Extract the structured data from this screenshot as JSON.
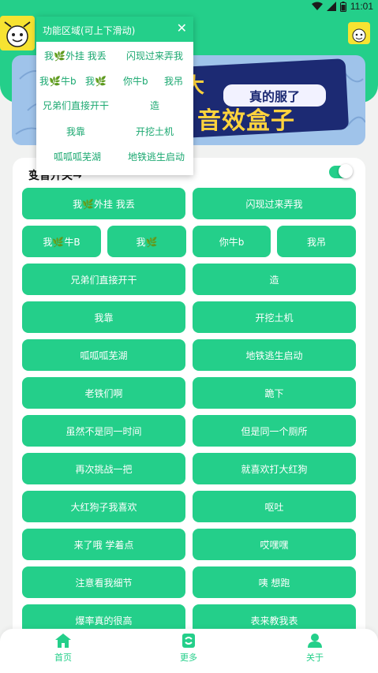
{
  "status_bar": {
    "time": "11:01"
  },
  "colors": {
    "primary": "#24cf8a",
    "popup_text": "#1aa870",
    "banner_dark": "#1c2a73",
    "banner_yellow": "#ffd33d"
  },
  "banner": {
    "tag": "真的服了",
    "title": "音效盒子",
    "left_char": "大"
  },
  "sound_panel": {
    "switch_label": "变音开关→",
    "switch_on": true
  },
  "sound_buttons_row1": [
    "我🌿外挂 我丢",
    "闪现过来弄我"
  ],
  "sound_buttons_row2": [
    "我🌿牛B",
    "我🌿",
    "你牛b",
    "我吊"
  ],
  "sound_buttons_rest": [
    "兄弟们直接开干",
    "造",
    "我靠",
    "开挖土机",
    "呱呱呱芜湖",
    "地铁逃生启动",
    "老铁们啊",
    "跪下",
    "虽然不是同一时间",
    "但是同一个厕所",
    "再次挑战一把",
    "就喜欢打大红狗",
    "大红狗子我喜欢",
    "呕吐",
    "来了哦 学着点",
    "哎嘿嘿",
    "注意看我细节",
    "咦 想跑",
    "爆率真的很高",
    "表来教我表"
  ],
  "popup": {
    "title": "功能区域(可上下滑动)",
    "close_symbol": "✕",
    "items": [
      "我🌿外挂 我丢",
      "闪现过来弄我",
      "我🌿牛b",
      "我🌿",
      "你牛b",
      "我吊",
      "兄弟们直接开干",
      "造",
      "我靠",
      "开挖土机",
      "呱呱呱芜湖",
      "地铁逃生启动"
    ]
  },
  "bottom_nav": [
    {
      "label": "首页",
      "icon": "home-icon"
    },
    {
      "label": "更多",
      "icon": "refresh-icon"
    },
    {
      "label": "关于",
      "icon": "user-icon"
    }
  ]
}
